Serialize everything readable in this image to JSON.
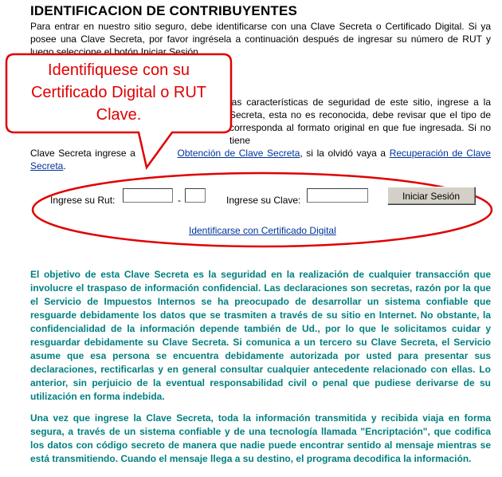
{
  "title": "IDENTIFICACION DE CONTRIBUYENTES",
  "intro": "Para entrar en nuestro sitio seguro, debe identificarse con una Clave Secreta o Certificado Digital. Si ya posee una Clave Secreta, por favor ingrésela a continuación después de ingresar su número de RUT y luego seleccione el botón Iniciar Sesión.",
  "security_text_visible": "las características de seguridad de este sitio, ingrese a la Secreta, esta no es reconocida, debe revisar que el tipo de corresponda al formato original en que fue ingresada. Si no tiene",
  "security_line4_prefix": "Clave Secreta ingrese a",
  "link_obtencion": "Obtención de Clave Secreta",
  "security_line4_mid": ", si la olvidó vaya a",
  "link_recuperacion": "Recuperación de Clave Secreta",
  "security_line4_end": ".",
  "callout": {
    "text": "Identifiquese con su Certificado Digital o RUT Clave.",
    "color": "#e00000"
  },
  "form": {
    "rut_label": "Ingrese su Rut:",
    "rut_value": "",
    "dv_separator": "-",
    "dv_value": "",
    "clave_label": "Ingrese su Clave:",
    "clave_value": "",
    "login_button": "Iniciar Sesión"
  },
  "cert_link": "Identificarse con Certificado Digital",
  "info_paragraph_1": "El objetivo de esta Clave Secreta es la seguridad en la realización de cualquier transacción que involucre el traspaso de información confidencial. Las declaraciones son secretas, razón por la que el Servicio de Impuestos Internos se ha preocupado de desarrollar un sistema confiable que resguarde debidamente los datos que se trasmiten a través de su sitio en Internet. No obstante, la confidencialidad de la información depende también de Ud., por lo que le solicitamos cuidar y resguardar debidamente su Clave Secreta. Si comunica a un tercero su Clave Secreta, el Servicio asume que esa persona se encuentra debidamente autorizada por usted para presentar sus declaraciones, rectificarlas y en general consultar cualquier antecedente relacionado con ellas. Lo anterior, sin perjuicio de la eventual responsabilidad civil o penal que pudiese derivarse de su utilización en forma indebida.",
  "info_paragraph_2": "Una vez que ingrese la Clave Secreta, toda la información transmitida y recibida viaja en forma segura, a través de un sistema confiable y de una tecnología llamada \"Encriptación\", que codifica los datos con código secreto de manera que nadie puede encontrar sentido al mensaje mientras se está transmitiendo. Cuando el mensaje llega a su destino, el programa decodifica la información.",
  "colors": {
    "link": "#00339a",
    "info_text": "#007f7f",
    "annotation": "#e00000"
  }
}
